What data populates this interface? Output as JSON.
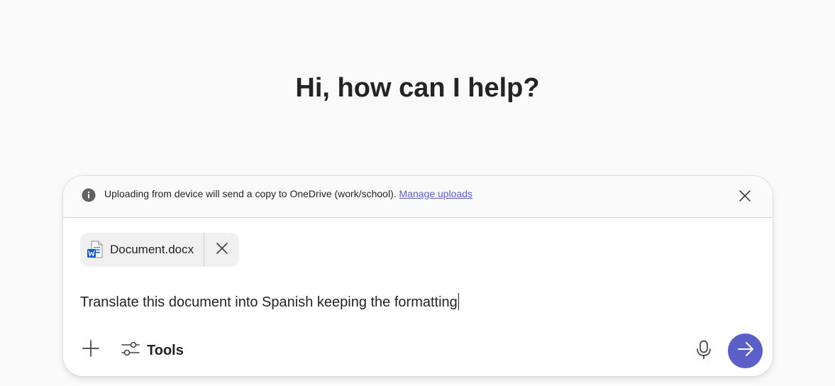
{
  "greeting": "Hi, how can I help?",
  "notice": {
    "text": "Uploading from device will send a copy to OneDrive (work/school).",
    "link_label": "Manage uploads",
    "icon": "info-icon",
    "close_icon": "close-icon"
  },
  "attachment": {
    "file_name": "Document.docx",
    "icon": "word-document-icon",
    "remove_icon": "close-icon"
  },
  "prompt": {
    "value": "Translate this document into Spanish keeping the formatting"
  },
  "toolbar": {
    "add_icon": "plus-icon",
    "tools_label": "Tools",
    "tools_icon": "sliders-icon",
    "mic_icon": "microphone-icon",
    "send_icon": "arrow-right-icon"
  },
  "colors": {
    "accent": "#5b5fc7",
    "background": "#fafafa",
    "text": "#242424",
    "word_blue": "#185abd"
  }
}
